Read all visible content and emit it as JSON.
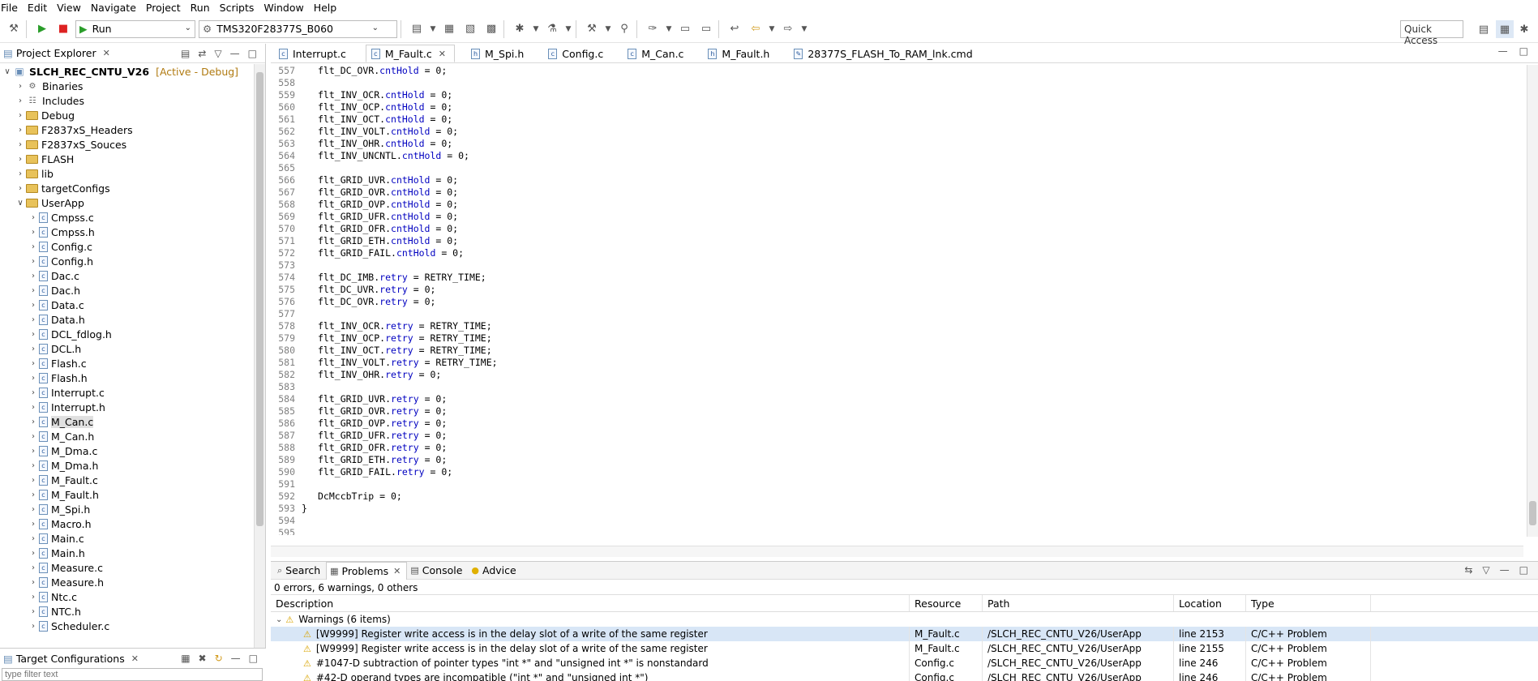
{
  "menu": [
    "File",
    "Edit",
    "View",
    "Navigate",
    "Project",
    "Run",
    "Scripts",
    "Window",
    "Help"
  ],
  "toolbar": {
    "run_combo": "Run",
    "target_combo": "TMS320F28377S_B060",
    "quick_access": "Quick Access"
  },
  "project_explorer": {
    "title": "Project Explorer",
    "root": "SLCH_REC_CNTU_V26",
    "root_status": "[Active - Debug]",
    "folders": [
      "Binaries",
      "Includes",
      "Debug",
      "F2837xS_Headers",
      "F2837xS_Souces",
      "FLASH",
      "lib",
      "targetConfigs",
      "UserApp"
    ],
    "files": [
      "Cmpss.c",
      "Cmpss.h",
      "Config.c",
      "Config.h",
      "Dac.c",
      "Dac.h",
      "Data.c",
      "Data.h",
      "DCL_fdlog.h",
      "DCL.h",
      "Flash.c",
      "Flash.h",
      "Interrupt.c",
      "Interrupt.h",
      "M_Can.c",
      "M_Can.h",
      "M_Dma.c",
      "M_Dma.h",
      "M_Fault.c",
      "M_Fault.h",
      "M_Spi.h",
      "Macro.h",
      "Main.c",
      "Main.h",
      "Measure.c",
      "Measure.h",
      "Ntc.c",
      "NTC.h",
      "Scheduler.c"
    ],
    "selected_file": "M_Can.c"
  },
  "target_configs": {
    "title": "Target Configurations",
    "filter_placeholder": "type filter text"
  },
  "editor": {
    "tabs": [
      "Interrupt.c",
      "M_Fault.c",
      "M_Spi.h",
      "Config.c",
      "M_Can.c",
      "M_Fault.h",
      "28377S_FLASH_To_RAM_lnk.cmd"
    ],
    "active_tab": "M_Fault.c",
    "lines": [
      {
        "n": "557",
        "obj": "flt_DC_OVR.",
        "mem": "cntHold",
        "rest": " = 0;"
      },
      {
        "n": "558",
        "obj": "",
        "mem": "",
        "rest": ""
      },
      {
        "n": "559",
        "obj": "flt_INV_OCR.",
        "mem": "cntHold",
        "rest": " = 0;"
      },
      {
        "n": "560",
        "obj": "flt_INV_OCP.",
        "mem": "cntHold",
        "rest": " = 0;"
      },
      {
        "n": "561",
        "obj": "flt_INV_OCT.",
        "mem": "cntHold",
        "rest": " = 0;"
      },
      {
        "n": "562",
        "obj": "flt_INV_VOLT.",
        "mem": "cntHold",
        "rest": " = 0;"
      },
      {
        "n": "563",
        "obj": "flt_INV_OHR.",
        "mem": "cntHold",
        "rest": " = 0;"
      },
      {
        "n": "564",
        "obj": "flt_INV_UNCNTL.",
        "mem": "cntHold",
        "rest": " = 0;"
      },
      {
        "n": "565",
        "obj": "",
        "mem": "",
        "rest": ""
      },
      {
        "n": "566",
        "obj": "flt_GRID_UVR.",
        "mem": "cntHold",
        "rest": " = 0;"
      },
      {
        "n": "567",
        "obj": "flt_GRID_OVR.",
        "mem": "cntHold",
        "rest": " = 0;"
      },
      {
        "n": "568",
        "obj": "flt_GRID_OVP.",
        "mem": "cntHold",
        "rest": " = 0;"
      },
      {
        "n": "569",
        "obj": "flt_GRID_UFR.",
        "mem": "cntHold",
        "rest": " = 0;"
      },
      {
        "n": "570",
        "obj": "flt_GRID_OFR.",
        "mem": "cntHold",
        "rest": " = 0;"
      },
      {
        "n": "571",
        "obj": "flt_GRID_ETH.",
        "mem": "cntHold",
        "rest": " = 0;"
      },
      {
        "n": "572",
        "obj": "flt_GRID_FAIL.",
        "mem": "cntHold",
        "rest": " = 0;"
      },
      {
        "n": "573",
        "obj": "",
        "mem": "",
        "rest": ""
      },
      {
        "n": "574",
        "obj": "flt_DC_IMB.",
        "mem": "retry",
        "rest": " = RETRY_TIME;"
      },
      {
        "n": "575",
        "obj": "flt_DC_UVR.",
        "mem": "retry",
        "rest": " = 0;"
      },
      {
        "n": "576",
        "obj": "flt_DC_OVR.",
        "mem": "retry",
        "rest": " = 0;"
      },
      {
        "n": "577",
        "obj": "",
        "mem": "",
        "rest": ""
      },
      {
        "n": "578",
        "obj": "flt_INV_OCR.",
        "mem": "retry",
        "rest": " = RETRY_TIME;"
      },
      {
        "n": "579",
        "obj": "flt_INV_OCP.",
        "mem": "retry",
        "rest": " = RETRY_TIME;"
      },
      {
        "n": "580",
        "obj": "flt_INV_OCT.",
        "mem": "retry",
        "rest": " = RETRY_TIME;"
      },
      {
        "n": "581",
        "obj": "flt_INV_VOLT.",
        "mem": "retry",
        "rest": " = RETRY_TIME;"
      },
      {
        "n": "582",
        "obj": "flt_INV_OHR.",
        "mem": "retry",
        "rest": " = 0;"
      },
      {
        "n": "583",
        "obj": "",
        "mem": "",
        "rest": ""
      },
      {
        "n": "584",
        "obj": "flt_GRID_UVR.",
        "mem": "retry",
        "rest": " = 0;"
      },
      {
        "n": "585",
        "obj": "flt_GRID_OVR.",
        "mem": "retry",
        "rest": " = 0;"
      },
      {
        "n": "586",
        "obj": "flt_GRID_OVP.",
        "mem": "retry",
        "rest": " = 0;"
      },
      {
        "n": "587",
        "obj": "flt_GRID_UFR.",
        "mem": "retry",
        "rest": " = 0;"
      },
      {
        "n": "588",
        "obj": "flt_GRID_OFR.",
        "mem": "retry",
        "rest": " = 0;"
      },
      {
        "n": "589",
        "obj": "flt_GRID_ETH.",
        "mem": "retry",
        "rest": " = 0;"
      },
      {
        "n": "590",
        "obj": "flt_GRID_FAIL.",
        "mem": "retry",
        "rest": " = 0;"
      },
      {
        "n": "591",
        "obj": "",
        "mem": "",
        "rest": ""
      },
      {
        "n": "592",
        "obj": "DcMccbTrip = 0;",
        "mem": "",
        "rest": ""
      },
      {
        "n": "593",
        "obj": "}",
        "mem": "",
        "rest": ""
      },
      {
        "n": "594",
        "obj": "",
        "mem": "",
        "rest": ""
      },
      {
        "n": "595",
        "obj": "",
        "mem": "",
        "rest": ""
      }
    ]
  },
  "bottom": {
    "tabs": [
      "Search",
      "Problems",
      "Console",
      "Advice"
    ],
    "active_tab": "Problems",
    "summary": "0 errors, 6 warnings, 0 others",
    "columns": [
      "Description",
      "Resource",
      "Path",
      "Location",
      "Type"
    ],
    "group": "Warnings (6 items)",
    "rows": [
      {
        "desc": "[W9999] Register write access is in the delay slot of a write of the same register",
        "res": "M_Fault.c",
        "path": "/SLCH_REC_CNTU_V26/UserApp",
        "loc": "line 2153",
        "type": "C/C++ Problem"
      },
      {
        "desc": "[W9999] Register write access is in the delay slot of a write of the same register",
        "res": "M_Fault.c",
        "path": "/SLCH_REC_CNTU_V26/UserApp",
        "loc": "line 2155",
        "type": "C/C++ Problem"
      },
      {
        "desc": "#1047-D subtraction of pointer types \"int *\" and \"unsigned int *\" is nonstandard",
        "res": "Config.c",
        "path": "/SLCH_REC_CNTU_V26/UserApp",
        "loc": "line 246",
        "type": "C/C++ Problem"
      },
      {
        "desc": "#42-D operand types are incompatible (\"int *\" and \"unsigned int *\")",
        "res": "Config.c",
        "path": "/SLCH_REC_CNTU_V26/UserApp",
        "loc": "line 246",
        "type": "C/C++ Problem"
      }
    ]
  }
}
